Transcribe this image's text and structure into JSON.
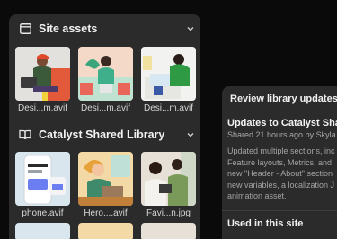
{
  "site_assets": {
    "title": "Site assets",
    "items": [
      {
        "name": "Desi...m.avif"
      },
      {
        "name": "Desi...m.avif"
      },
      {
        "name": "Desi...m.avif"
      }
    ]
  },
  "shared_library": {
    "title": "Catalyst Shared Library",
    "items": [
      {
        "name": "phone.avif"
      },
      {
        "name": "Hero....avif"
      },
      {
        "name": "Favi...n.jpg"
      }
    ]
  },
  "review": {
    "header": "Review library updates",
    "update_title": "Updates to Catalyst Shar",
    "update_meta": "Shared 21 hours ago by Skyla",
    "body_lines": [
      "Updated multiple sections, inc",
      "Feature layouts, Metrics, and",
      "new \"Header - About\" section",
      "new variables, a localization J",
      "animation asset."
    ],
    "used_in_site": "Used in this site"
  },
  "icons": {
    "site_assets": "window-icon",
    "library": "book-icon",
    "collapse": "chevron-down-icon"
  }
}
